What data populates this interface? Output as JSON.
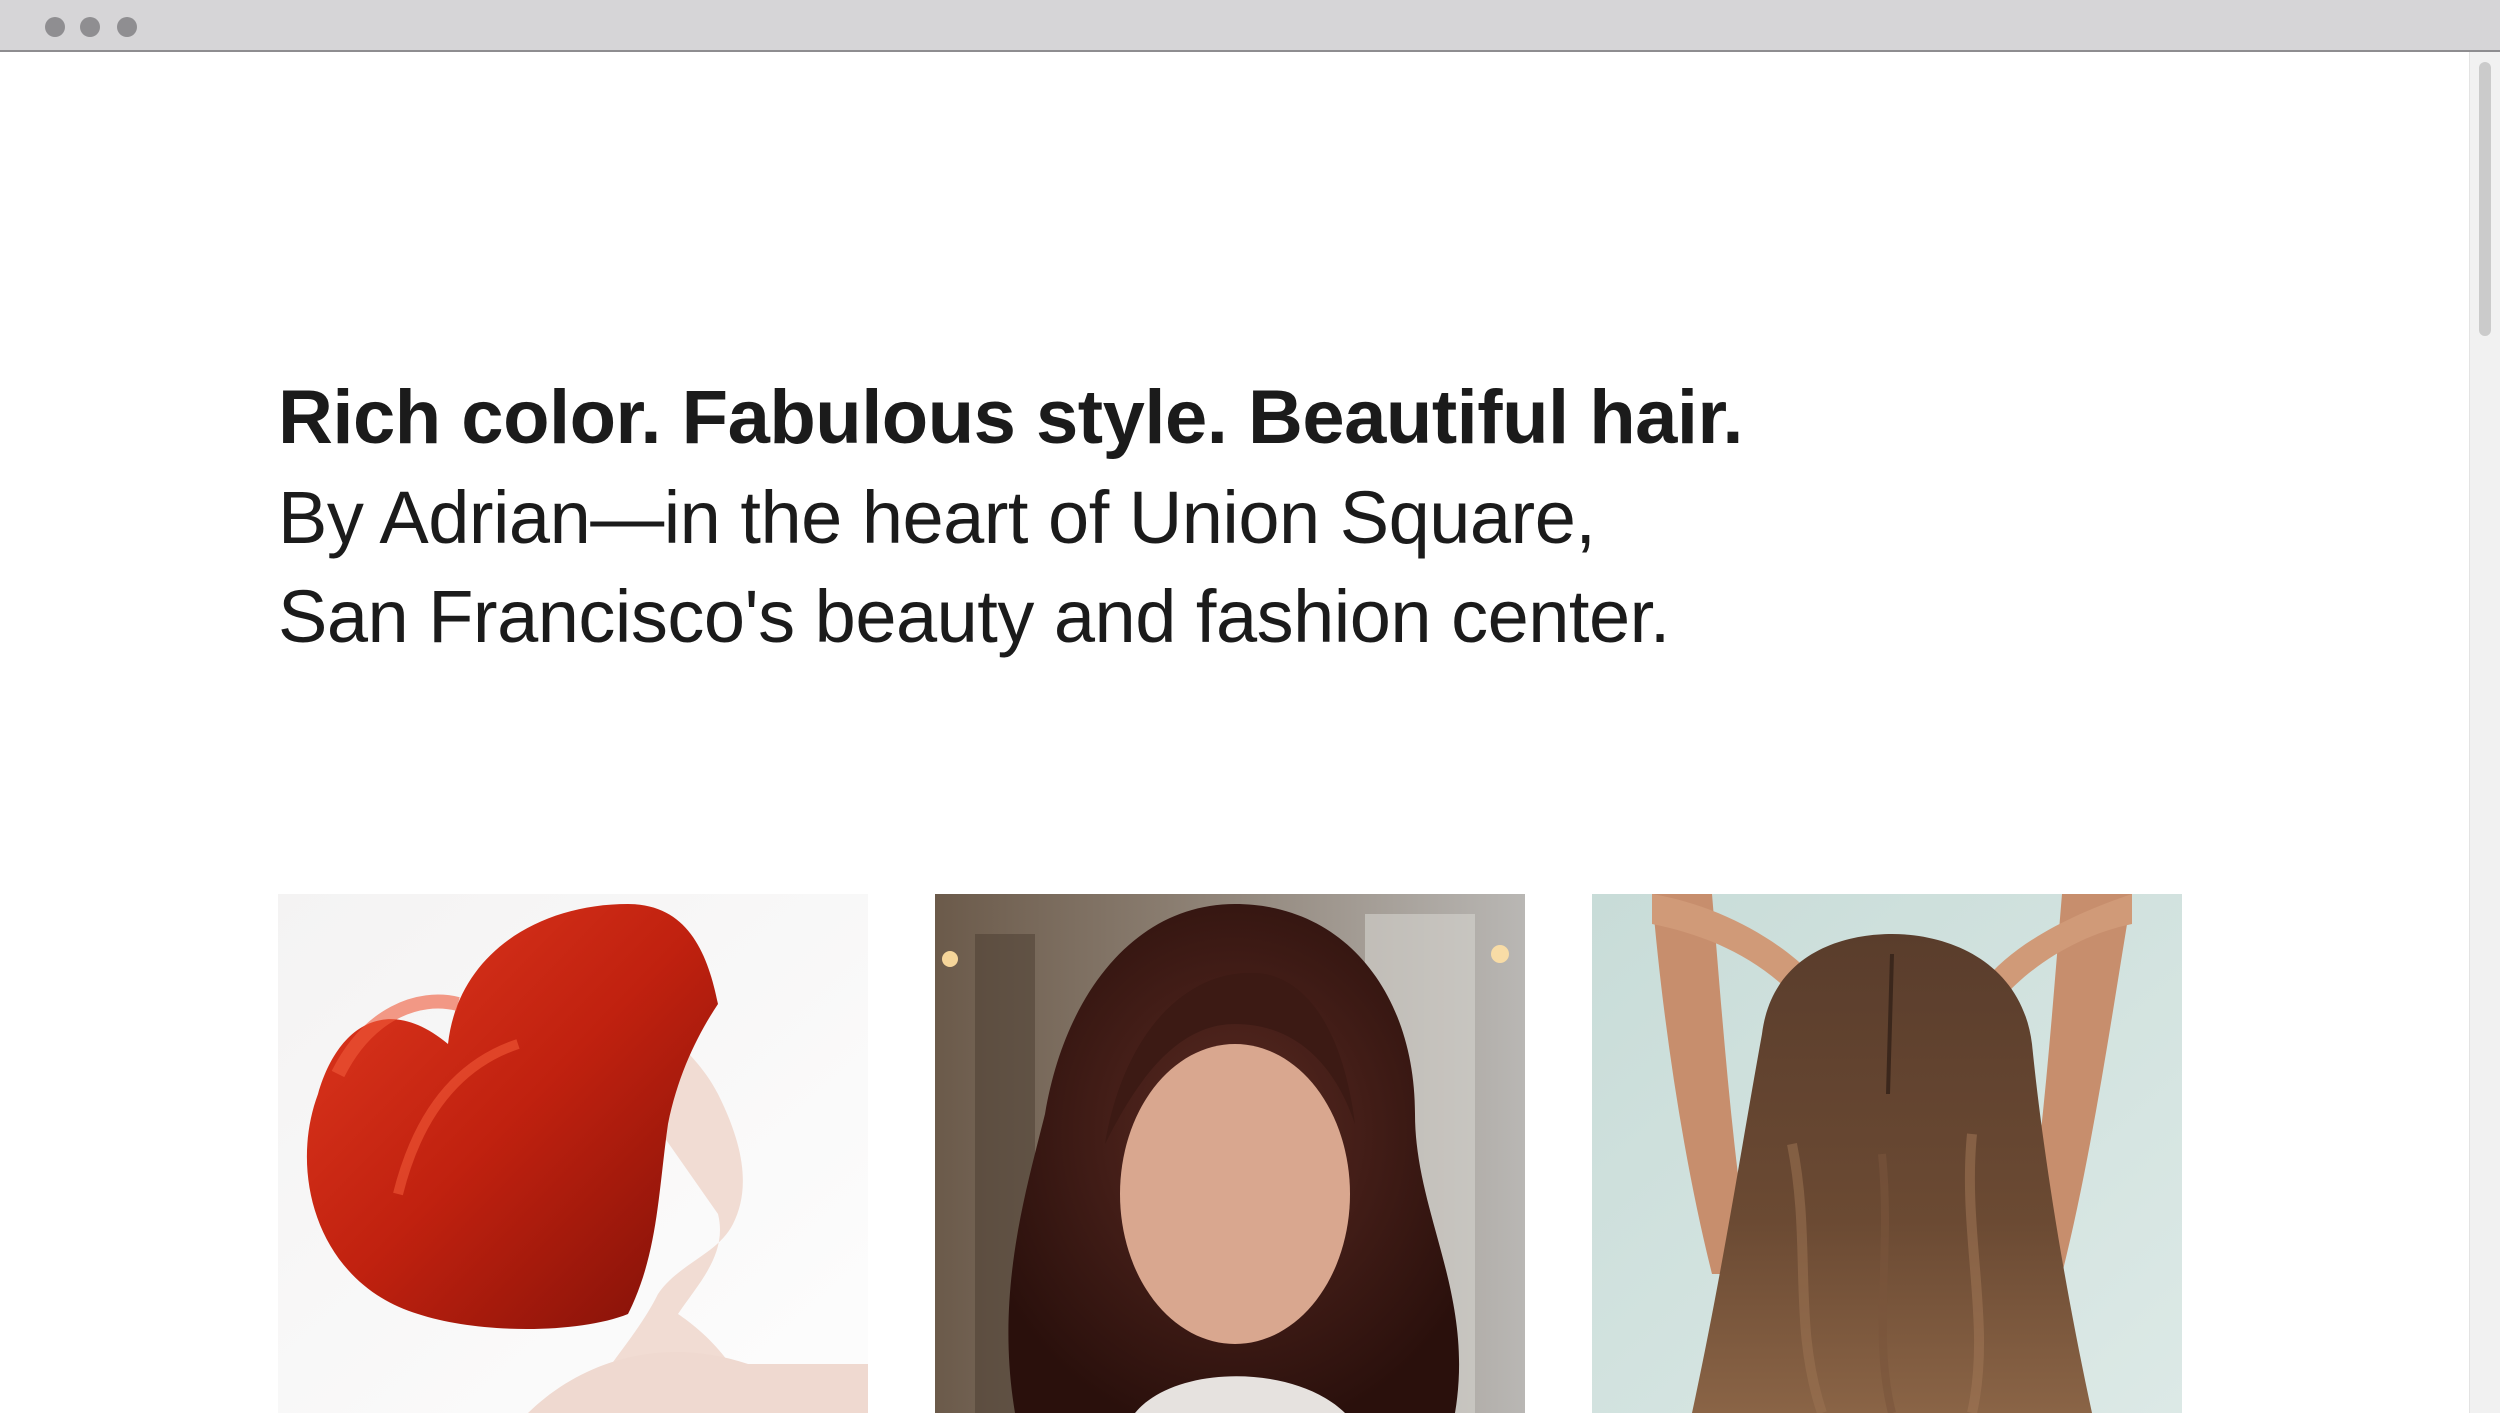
{
  "window": {
    "controls": [
      "close-icon",
      "minimize-icon",
      "zoom-icon"
    ]
  },
  "hero": {
    "headline": "Rich color. Fabulous style. Beautiful hair.",
    "subline_1": "By Adrian—in the heart of Union Square,",
    "subline_2": "San Francisco's beauty and fashion center."
  },
  "gallery": {
    "photos": [
      {
        "subject": "woman-red-bob-profile"
      },
      {
        "subject": "woman-dark-wavy-hair-portrait"
      },
      {
        "subject": "woman-long-brown-hair-from-behind"
      }
    ]
  },
  "colors": {
    "text": "#1b1b1b",
    "titlebar": "#d6d5d7"
  }
}
